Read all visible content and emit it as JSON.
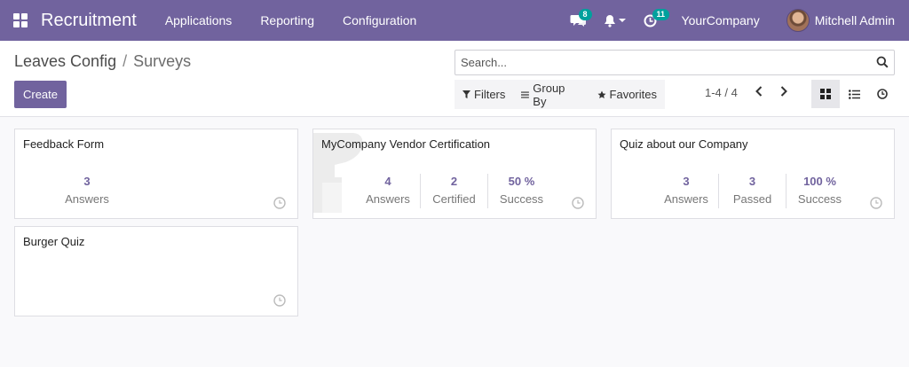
{
  "navbar": {
    "brand": "Recruitment",
    "menu": [
      "Applications",
      "Reporting",
      "Configuration"
    ],
    "messages_badge": "8",
    "activities_badge": "11",
    "company": "YourCompany",
    "user": "Mitchell Admin",
    "icons": [
      "apps-grid-icon",
      "chat-icon",
      "bell-icon",
      "clock-icon"
    ]
  },
  "breadcrumb": {
    "parent": "Leaves Config",
    "separator": "/",
    "current": "Surveys"
  },
  "create_label": "Create",
  "search": {
    "placeholder": "Search..."
  },
  "filters": {
    "filters": "Filters",
    "group_by": "Group By",
    "favorites": "Favorites"
  },
  "pager": "1-4 / 4",
  "cards": [
    {
      "title": "Feedback Form",
      "stats": [
        {
          "value": "3",
          "label": "Answers"
        }
      ]
    },
    {
      "title": "MyCompany Vendor Certification",
      "stats": [
        {
          "value": "4",
          "label": "Answers"
        },
        {
          "value": "2",
          "label": "Certified"
        },
        {
          "value": "50 %",
          "label": "Success"
        }
      ]
    },
    {
      "title": "Quiz about our Company",
      "stats": [
        {
          "value": "3",
          "label": "Answers"
        },
        {
          "value": "3",
          "label": "Passed"
        },
        {
          "value": "100 %",
          "label": "Success"
        }
      ]
    },
    {
      "title": "Burger Quiz",
      "stats": []
    }
  ],
  "colors": {
    "primary": "#71639e",
    "badge": "#00a09d"
  }
}
